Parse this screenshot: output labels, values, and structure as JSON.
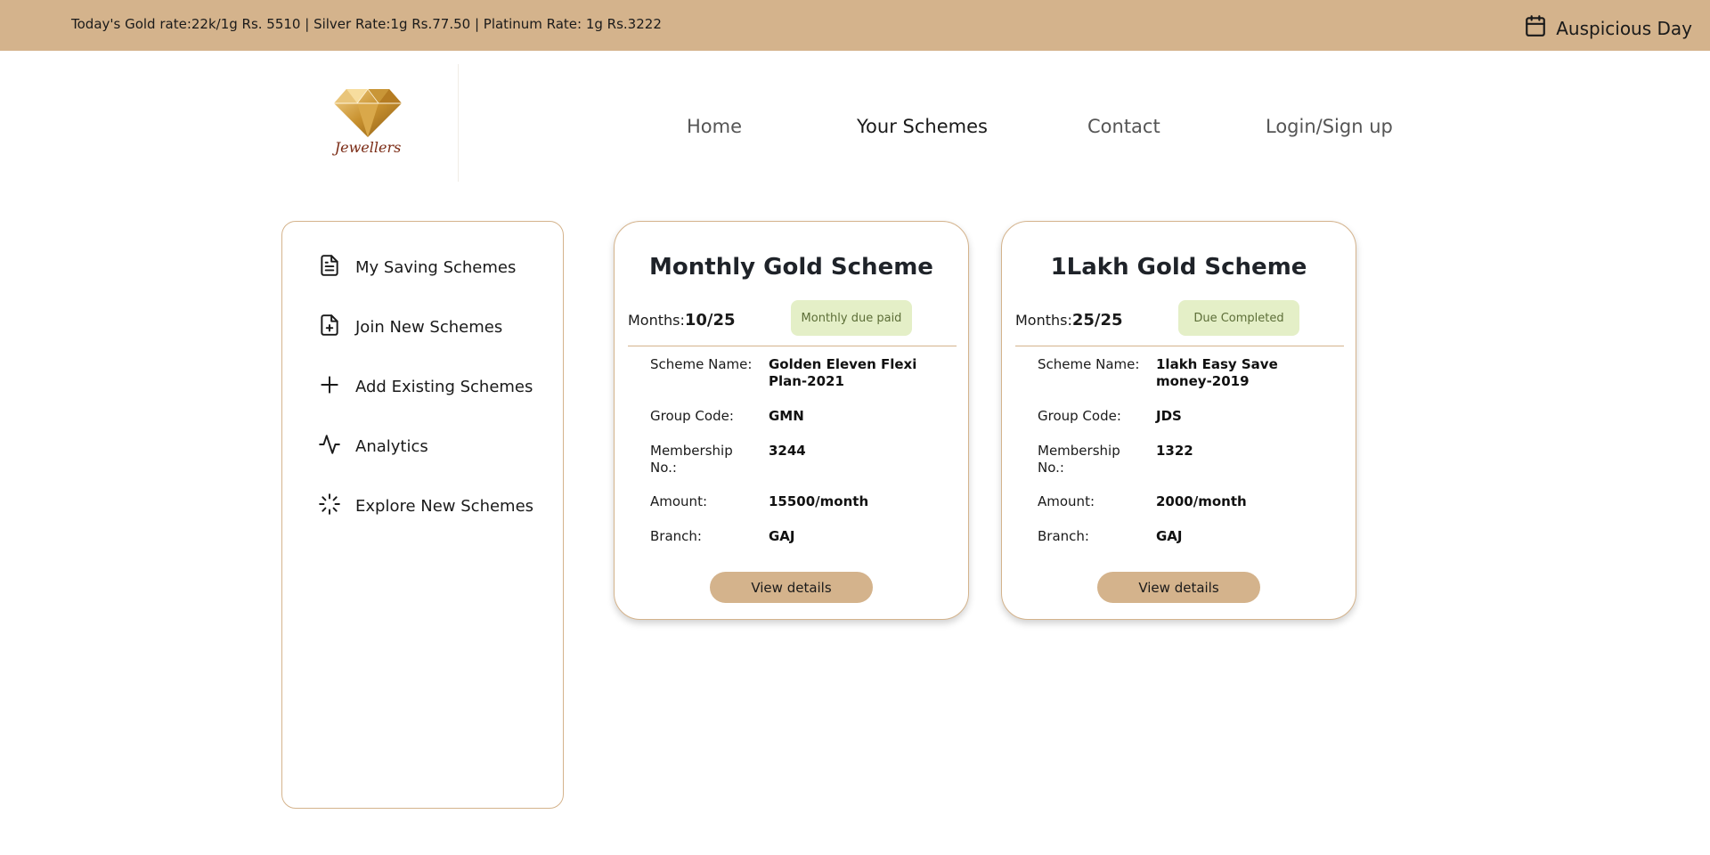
{
  "topbar": {
    "rates_text": "Today's Gold rate:22k/1g Rs. 5510 | Silver Rate:1g Rs.77.50 | Platinum Rate: 1g Rs.3222",
    "auspicious_label": "Auspicious Day",
    "background": "#d4b38c"
  },
  "logo": {
    "text": "Jewellers"
  },
  "nav": {
    "items": [
      {
        "label": "Home"
      },
      {
        "label": "Your Schemes"
      },
      {
        "label": "Contact"
      },
      {
        "label": "Login/Sign up"
      }
    ],
    "active": "Your Schemes"
  },
  "sidebar": {
    "items": [
      {
        "label": "My Saving Schemes",
        "icon": "file-text-icon"
      },
      {
        "label": "Join New Schemes",
        "icon": "file-plus-icon"
      },
      {
        "label": "Add Existing Schemes",
        "icon": "plus-icon"
      },
      {
        "label": "Analytics",
        "icon": "activity-icon"
      },
      {
        "label": "Explore New Schemes",
        "icon": "loader-icon"
      }
    ]
  },
  "labels": {
    "months": "Months:",
    "scheme_name": "Scheme Name:",
    "group_code": "Group Code:",
    "membership": "Membership No.:",
    "amount": "Amount:",
    "branch": "Branch:",
    "view_details": "View details"
  },
  "cards": [
    {
      "title": "Monthly Gold Scheme",
      "months": "10/25",
      "status": "Monthly due paid",
      "scheme_name": "Golden Eleven Flexi Plan-2021",
      "group_code": "GMN",
      "membership_no": "3244",
      "amount": "15500/month",
      "branch": "GAJ"
    },
    {
      "title": "1Lakh Gold Scheme",
      "months": "25/25",
      "status": "Due Completed",
      "scheme_name": "1lakh Easy Save money-2019",
      "group_code": "JDS",
      "membership_no": "1322",
      "amount": "2000/month",
      "branch": "GAJ"
    }
  ],
  "colors": {
    "accent": "#d4b38c",
    "badge_bg": "#e4efc7",
    "badge_text": "#5c6e37",
    "logo_text": "#7a2a14"
  }
}
